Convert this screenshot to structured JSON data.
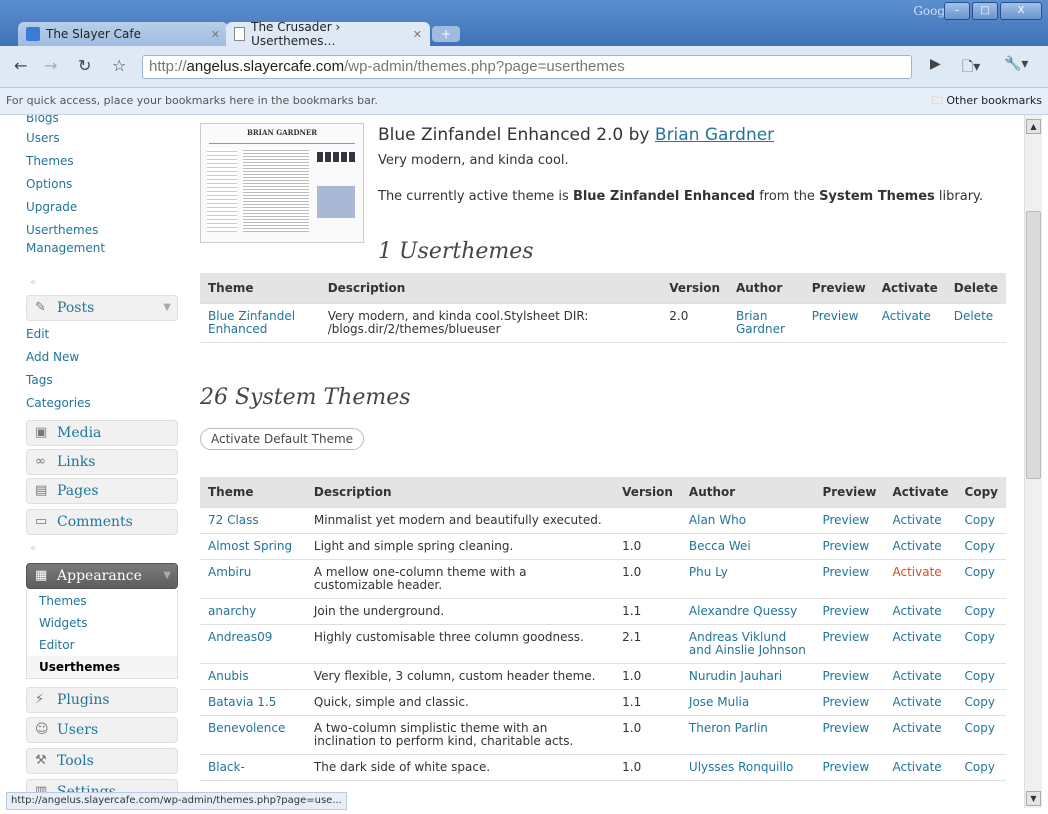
{
  "browser": {
    "tabs": [
      {
        "label": "The Slayer Cafe",
        "active": false
      },
      {
        "label": "The Crusader › Userthemes…",
        "active": true
      }
    ],
    "google_label": "Google",
    "url_scheme": "http://",
    "url_host": "angelus.slayercafe.com",
    "url_path": "/wp-admin/themes.php?page=userthemes",
    "bookmarks_hint": "For quick access, place your bookmarks here in the bookmarks bar.",
    "other_bookmarks": "Other bookmarks",
    "status_url": "http://angelus.slayercafe.com/wp-admin/themes.php?page=use..."
  },
  "sidebar": {
    "top_items": [
      "Blogs",
      "Users",
      "Themes",
      "Options",
      "Upgrade",
      "Userthemes",
      "Management"
    ],
    "posts": {
      "label": "Posts",
      "items": [
        "Edit",
        "Add New",
        "Tags",
        "Categories"
      ]
    },
    "media": "Media",
    "links": "Links",
    "pages": "Pages",
    "comments": "Comments",
    "appearance": {
      "label": "Appearance",
      "items": [
        "Themes",
        "Widgets",
        "Editor",
        "Userthemes"
      ],
      "current": "Userthemes"
    },
    "plugins": "Plugins",
    "users": "Users",
    "tools": "Tools",
    "settings": "Settings"
  },
  "current_theme": {
    "name": "Blue Zinfandel Enhanced 2.0 by",
    "author": "Brian Gardner",
    "description": "Very modern, and kinda cool.",
    "active_prefix": "The currently active theme is ",
    "active_theme": "Blue Zinfandel Enhanced",
    "active_mid": " from the ",
    "library": "System Themes",
    "active_suffix": " library.",
    "screenshot_title": "BRIAN GARDNER"
  },
  "userthemes": {
    "heading": "1 Userthemes",
    "columns": [
      "Theme",
      "Description",
      "Version",
      "Author",
      "Preview",
      "Activate",
      "Delete"
    ],
    "rows": [
      {
        "theme": "Blue Zinfandel Enhanced",
        "description": "Very modern, and kinda cool.Stylsheet DIR: /blogs.dir/2/themes/blueuser",
        "version": "2.0",
        "author": "Brian Gardner",
        "preview": "Preview",
        "activate": "Activate",
        "delete": "Delete"
      }
    ]
  },
  "system_themes": {
    "heading": "26 System Themes",
    "default_button": "Activate Default Theme",
    "columns": [
      "Theme",
      "Description",
      "Version",
      "Author",
      "Preview",
      "Activate",
      "Copy"
    ],
    "rows": [
      {
        "theme": "72 Class",
        "description": "Minmalist yet modern and beautifully executed.",
        "version": "",
        "author": "Alan Who"
      },
      {
        "theme": "Almost Spring",
        "description": "Light and simple spring cleaning.",
        "version": "1.0",
        "author": "Becca Wei"
      },
      {
        "theme": "Ambiru",
        "description": "A mellow one-column theme with a customizable header.",
        "version": "1.0",
        "author": "Phu Ly"
      },
      {
        "theme": "anarchy",
        "description": "Join the underground.",
        "version": "1.1",
        "author": "Alexandre Quessy"
      },
      {
        "theme": "Andreas09",
        "description": "Highly customisable three column goodness.",
        "version": "2.1",
        "author": "Andreas Viklund and Ainslie Johnson"
      },
      {
        "theme": "Anubis",
        "description": "Very flexible, 3 column, custom header theme.",
        "version": "1.0",
        "author": "Nurudin Jauhari"
      },
      {
        "theme": "Batavia 1.5",
        "description": "Quick, simple and classic.",
        "version": "1.1",
        "author": "Jose Mulia"
      },
      {
        "theme": "Benevolence",
        "description": "A two-column simplistic theme with an inclination to perform kind, charitable acts.",
        "version": "1.0",
        "author": "Theron Parlin"
      },
      {
        "theme": "Black-",
        "description": "The dark side of white space.",
        "version": "1.0",
        "author": "Ulysses Ronquillo"
      }
    ],
    "preview_label": "Preview",
    "activate_label": "Activate",
    "copy_label": "Copy",
    "hover_row": 2,
    "hover_color": "#d54e21"
  }
}
